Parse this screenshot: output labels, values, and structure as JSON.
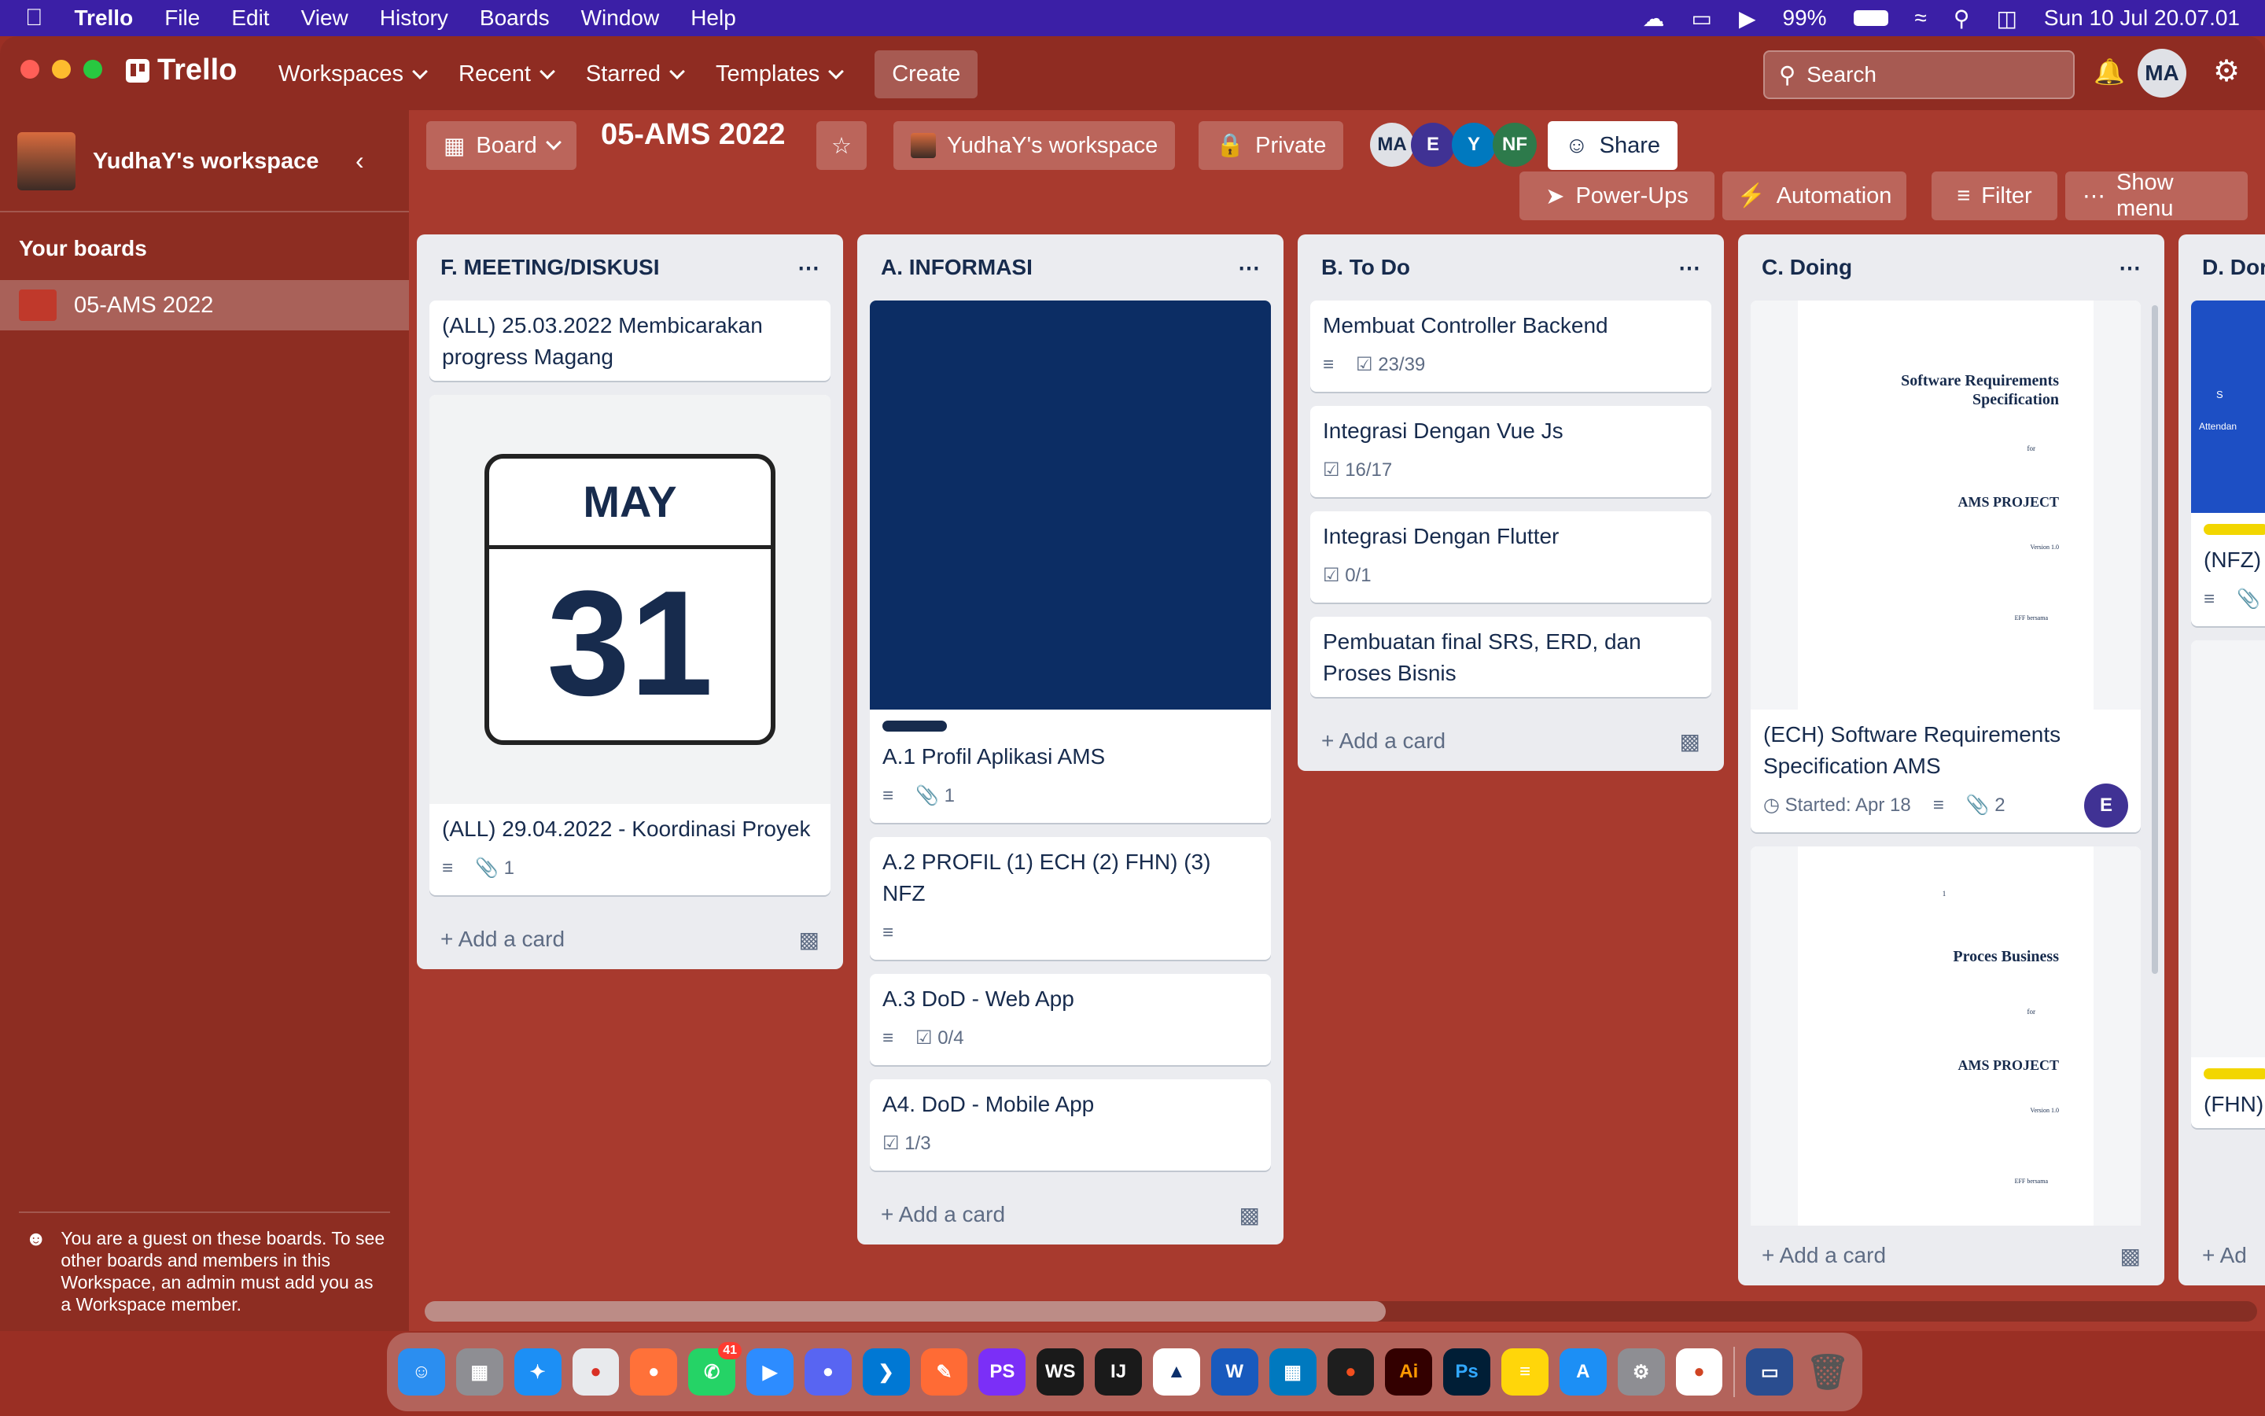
{
  "menubar": {
    "app": "Trello",
    "items": [
      "File",
      "Edit",
      "View",
      "History",
      "Boards",
      "Window",
      "Help"
    ],
    "battery": "99%",
    "datetime": "Sun 10 Jul  20.07.01"
  },
  "nav": {
    "logo": "Trello",
    "workspaces": "Workspaces",
    "recent": "Recent",
    "starred": "Starred",
    "templates": "Templates",
    "create": "Create",
    "search_placeholder": "Search",
    "user_initials": "MA"
  },
  "sidebar": {
    "workspace": "YudhaY's workspace",
    "your_boards": "Your boards",
    "board": "05-AMS 2022",
    "guest_note": "You are a guest on these boards. To see other boards and members in this Workspace, an admin must add you as a Workspace member."
  },
  "board": {
    "view": "Board",
    "title": "05-AMS 2022",
    "workspace": "YudhaY's workspace",
    "visibility": "Private",
    "members": [
      "MA",
      "E",
      "Y",
      "NF"
    ],
    "share": "Share",
    "powerups": "Power-Ups",
    "automation": "Automation",
    "filter": "Filter",
    "menu": "Show menu"
  },
  "lists": [
    {
      "title": "F. MEETING/DISKUSI",
      "add": "Add a card",
      "cards": [
        {
          "text": "(ALL) 25.03.2022 Membicarakan progress Magang"
        },
        {
          "cover_month": "MAY",
          "cover_day": "31",
          "text": "(ALL) 29.04.2022 - Koordinasi Proyek",
          "attachments": "1"
        }
      ]
    },
    {
      "title": "A. INFORMASI",
      "add": "Add a card",
      "cards": [
        {
          "text": "A.1 Profil Aplikasi AMS",
          "attachments": "1"
        },
        {
          "text": "A.2 PROFIL (1) ECH (2) FHN) (3) NFZ"
        },
        {
          "text": "A.3 DoD - Web App",
          "checklist": "0/4"
        },
        {
          "text": "A4. DoD - Mobile App",
          "checklist": "1/3"
        }
      ]
    },
    {
      "title": "B. To Do",
      "add": "Add a card",
      "cards": [
        {
          "text": "Membuat Controller Backend",
          "checklist": "23/39"
        },
        {
          "text": "Integrasi Dengan Vue Js",
          "checklist": "16/17"
        },
        {
          "text": "Integrasi Dengan Flutter",
          "checklist": "0/1"
        },
        {
          "text": "Pembuatan final SRS, ERD, dan Proses Bisnis"
        }
      ]
    },
    {
      "title": "C. Doing",
      "add": "Add a card",
      "cards": [
        {
          "doc_title": "Software Requirements Specification",
          "doc_for": "for",
          "doc_project": "AMS PROJECT",
          "doc_version": "Version 1.0",
          "doc_by": "EFF bersama",
          "text": "(ECH) Software Requirements Specification AMS",
          "started": "Started: Apr 18",
          "attachments": "2",
          "member": "E"
        },
        {
          "doc_page": "1",
          "doc_title": "Proces Business",
          "doc_for": "for",
          "doc_project": "AMS PROJECT",
          "doc_version": "Version 1.0",
          "doc_by": "EFF bersama"
        }
      ]
    },
    {
      "title": "D. Dor",
      "cards": [
        {
          "cover_title": "S",
          "cover_sub": "Attendan",
          "text": "(NFZ) Dashb"
        },
        {
          "text": "(FHN) Dashb"
        }
      ],
      "add": "Ad"
    }
  ],
  "dock": {
    "whatsapp_badge": "41",
    "apps": [
      "PS",
      "WS",
      "IJ",
      "Ai",
      "Ps"
    ]
  },
  "colors": {
    "board_bg": "#a83a2e",
    "nav": "#8f2c22",
    "menubar": "#3b1fa6",
    "info_cover": "#0c2d64"
  }
}
